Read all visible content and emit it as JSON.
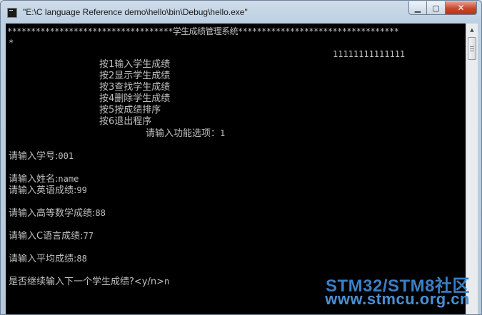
{
  "window": {
    "title": "\"E:\\C language Reference demo\\hello\\bin\\Debug\\hello.exe\"",
    "caption": {
      "minimize": "▁",
      "maximize": "▢",
      "close": "✕"
    }
  },
  "console": {
    "header": "***********************************学生成绩管理系统**********************************",
    "star_line": "*",
    "ones": "11111111111111",
    "menu": [
      "按1输入学生成绩",
      "按2显示学生成绩",
      "按3查找学生成绩",
      "按4删除学生成绩",
      "按5按成绩排序",
      "按6退出程序"
    ],
    "option_prompt": "请输入功能选项：",
    "option_value": "1",
    "inputs": [
      {
        "label": "请输入学号:",
        "value": "001"
      },
      {
        "label": "请输入姓名:",
        "value": "name"
      },
      {
        "label": "请输入英语成绩:",
        "value": "99"
      },
      {
        "label": "请输入高等数学成绩:",
        "value": "88"
      },
      {
        "label": "请输入C语言成绩:",
        "value": "77"
      },
      {
        "label": "请输入平均成绩:",
        "value": "88"
      }
    ],
    "continue_prompt": "是否继续输入下一个学生成绩?<y/n>",
    "continue_value": "n"
  },
  "watermark": {
    "line1": "STM32/STM8社区",
    "line2": "www.stmcu.org.cn"
  },
  "colors": {
    "console_bg": "#000000",
    "console_text": "#c0c0c0",
    "watermark": "#3a7fc4"
  }
}
